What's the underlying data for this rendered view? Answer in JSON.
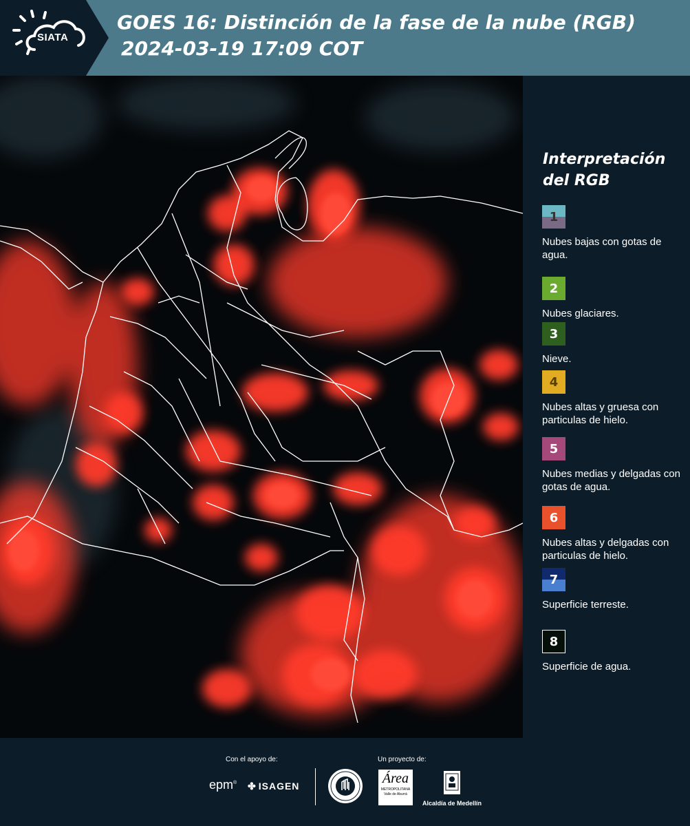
{
  "header": {
    "logo_text": "SIATA",
    "title_line1": "GOES 16: Distinción de la fase de la nube (RGB)",
    "title_line2": "2024-03-19 17:09 COT"
  },
  "map": {
    "background_color": "#05080b",
    "cloud_color": "#ff3b2a",
    "border_color": "#ffffff"
  },
  "legend": {
    "title_line1": "Interpretación",
    "title_line2": "del RGB",
    "items": [
      {
        "number": "1",
        "label": "Nubes bajas con gotas de agua.",
        "color_top": "#6bb8c4",
        "color_bottom": "#7a6a86",
        "number_color": "#333333"
      },
      {
        "number": "2",
        "label": "Nubes glaciares.",
        "color_top": "#6aaa2e",
        "color_bottom": "#6aaa2e",
        "number_color": "#ffffff"
      },
      {
        "number": "3",
        "label": "Nieve.",
        "color_top": "#2f5f1e",
        "color_bottom": "#2f5f1e",
        "number_color": "#ffffff"
      },
      {
        "number": "4",
        "label": "Nubes altas y gruesa con particulas de hielo.",
        "color_top": "#e2ac22",
        "color_bottom": "#e2ac22",
        "number_color": "#5a3e00"
      },
      {
        "number": "5",
        "label": "Nubes medias y delgadas con gotas de agua.",
        "color_top": "#a5497a",
        "color_bottom": "#a5497a",
        "number_color": "#ffffff"
      },
      {
        "number": "6",
        "label": "Nubes altas y delgadas con particulas de hielo.",
        "color_top": "#e9502c",
        "color_bottom": "#e9502c",
        "number_color": "#ffffff"
      },
      {
        "number": "7",
        "label": "Superficie terreste.",
        "color_top": "#112a6e",
        "color_bottom": "#4a7fd0",
        "number_color": "#ffffff"
      },
      {
        "number": "8",
        "label": "Superficie de agua.",
        "color_top": "#05100a",
        "color_bottom": "#05100a",
        "number_color": "#ffffff"
      }
    ]
  },
  "footer": {
    "support_label": "Con el apoyo de:",
    "project_label": "Un proyecto de:",
    "epm_text": "epm",
    "isagen_text": "ISAGEN",
    "area_text": "Área",
    "area_subtext": "METROPOLITANA Valle de Aburrá",
    "medellin_text": "Alcaldía de Medellín"
  },
  "icons": {
    "logo": "sun-cloud-icon",
    "isagen_mark": "isagen-mark-icon",
    "seal": "government-seal-icon",
    "coat": "coat-of-arms-icon"
  }
}
